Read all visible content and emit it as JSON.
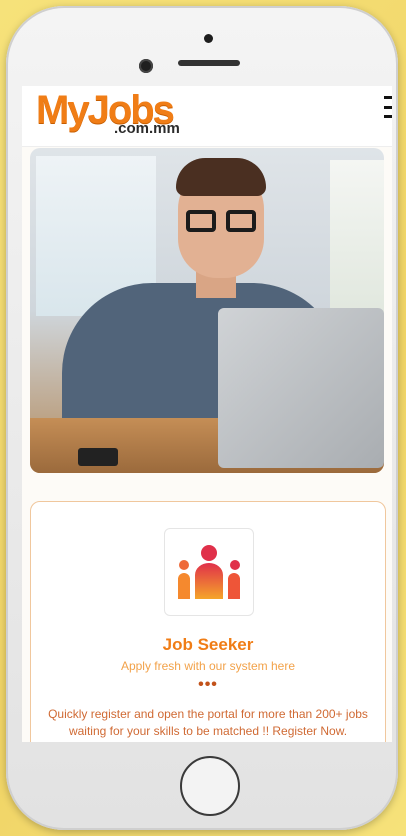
{
  "brand": {
    "logo_main": "MyJobs",
    "logo_sub": ".com.mm",
    "accent": "#f07d16"
  },
  "header": {
    "menu_icon": "hamburger-menu-icon"
  },
  "hero": {
    "image": "man-smiling-with-laptop-photo"
  },
  "card": {
    "icon": "people-group-icon",
    "title": "Job Seeker",
    "subtitle": "Apply fresh with our system here",
    "dots": "•••",
    "description": "Quickly register and open the portal for more than 200+ jobs waiting for your skills to be matched !! Register Now."
  }
}
